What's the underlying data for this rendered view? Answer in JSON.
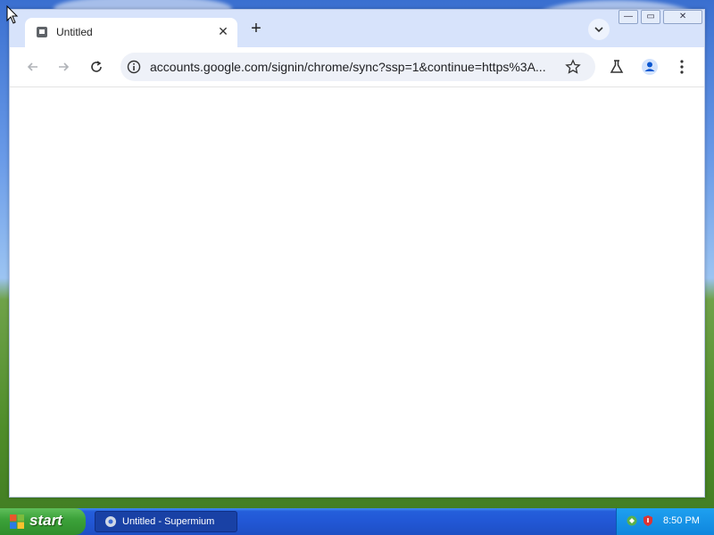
{
  "browser": {
    "tab": {
      "title": "Untitled",
      "close_icon": "close-icon",
      "favicon": "page-icon"
    },
    "new_tab_label": "+",
    "window_buttons": {
      "minimize": "minimize-icon",
      "maximize": "maximize-icon",
      "close": "close-icon"
    },
    "toolbar": {
      "back_icon": "arrow-left-icon",
      "forward_icon": "arrow-right-icon",
      "reload_icon": "reload-icon",
      "address_url": "accounts.google.com/signin/chrome/sync?ssp=1&continue=https%3A...",
      "star_icon": "star-icon",
      "labs_icon": "flask-icon",
      "profile_icon": "profile-icon",
      "menu_icon": "menu-dots-icon"
    }
  },
  "taskbar": {
    "start_label": "start",
    "task_item_label": "Untitled - Supermium",
    "clock": "8:50 PM"
  },
  "colors": {
    "tabstrip": "#d7e3fb",
    "omnibox": "#eef1f8",
    "taskbar": "#245edb",
    "start": "#3ca23a",
    "tray": "#0f86dd"
  }
}
